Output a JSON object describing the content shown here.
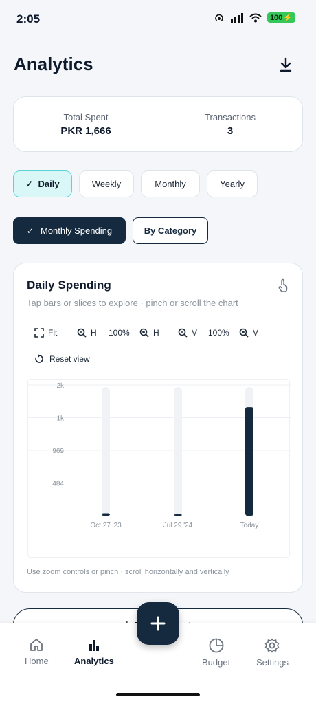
{
  "status": {
    "time": "2:05",
    "battery": "100"
  },
  "header": {
    "title": "Analytics",
    "download_icon": "download-icon"
  },
  "summary": {
    "total_label": "Total Spent",
    "total_value": "PKR 1,666",
    "tx_label": "Transactions",
    "tx_value": "3"
  },
  "periods": [
    {
      "label": "Daily",
      "active": true
    },
    {
      "label": "Weekly",
      "active": false
    },
    {
      "label": "Monthly",
      "active": false
    },
    {
      "label": "Yearly",
      "active": false
    }
  ],
  "views": [
    {
      "label": "Monthly Spending",
      "active": true
    },
    {
      "label": "By Category",
      "active": false
    }
  ],
  "card": {
    "title": "Daily Spending",
    "subtitle": "Tap bars or slices to explore · pinch or scroll the chart",
    "controls": {
      "fit": "Fit",
      "h_out": "H",
      "h_zoom": "100%",
      "h_in": "H",
      "v_out": "V",
      "v_zoom": "100%",
      "v_in": "V",
      "reset": "Reset view"
    },
    "footnote": "Use zoom controls or pinch · scroll horizontally and vertically"
  },
  "chart_data": {
    "type": "bar",
    "categories": [
      "Oct 27 '23",
      "Jul 29 '24",
      "Today"
    ],
    "values": [
      36,
      20,
      1610
    ],
    "ytick_labels": [
      "2k",
      "1k",
      "969",
      "484"
    ],
    "ytick_values": [
      1938,
      1453,
      969,
      484
    ],
    "ylim": [
      0,
      1938
    ],
    "bar_color": "#15293f",
    "track_color": "#f0f2f5"
  },
  "export": {
    "label": "Export report"
  },
  "fab": {
    "icon": "plus-icon"
  },
  "nav": [
    {
      "label": "Home",
      "icon": "home-icon",
      "active": false
    },
    {
      "label": "Analytics",
      "icon": "bar-chart-icon",
      "active": true
    },
    {
      "label": "Budget",
      "icon": "pie-chart-icon",
      "active": false
    },
    {
      "label": "Settings",
      "icon": "gear-icon",
      "active": false
    }
  ]
}
